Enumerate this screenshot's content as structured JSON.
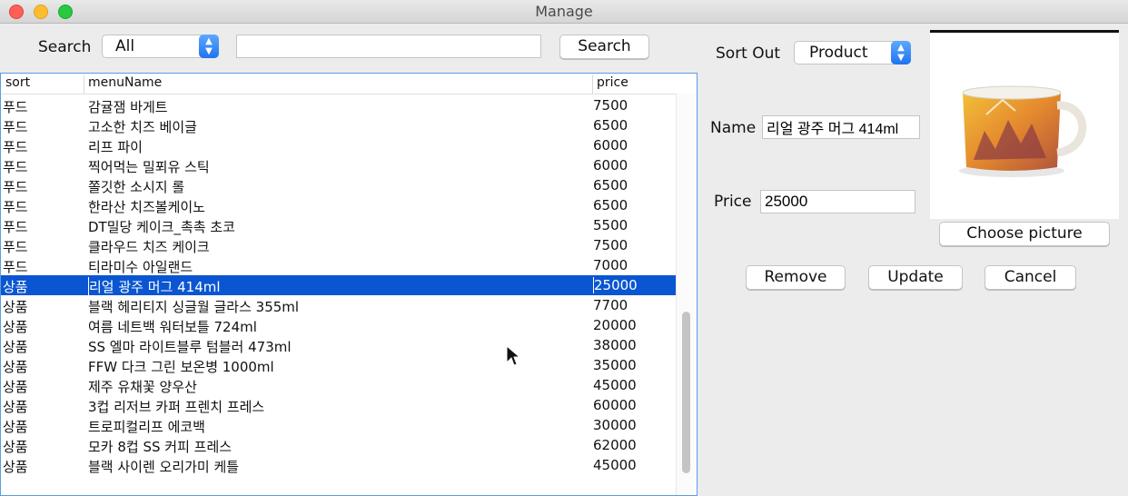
{
  "window": {
    "title": "Manage"
  },
  "search": {
    "label": "Search",
    "filter_value": "All",
    "query_value": "",
    "button_label": "Search"
  },
  "table": {
    "headers": {
      "sort": "sort",
      "menuName": "menuName",
      "price": "price"
    },
    "rows": [
      {
        "sort": "푸드",
        "menuName": "감귤잼 바게트",
        "price": "7500"
      },
      {
        "sort": "푸드",
        "menuName": "고소한 치즈 베이글",
        "price": "6500"
      },
      {
        "sort": "푸드",
        "menuName": "리프 파이",
        "price": "6000"
      },
      {
        "sort": "푸드",
        "menuName": "찍어먹는 밀푀유 스틱",
        "price": "6000"
      },
      {
        "sort": "푸드",
        "menuName": "쫄깃한 소시지 롤",
        "price": "6500"
      },
      {
        "sort": "푸드",
        "menuName": "한라산 치즈볼케이노",
        "price": "6500"
      },
      {
        "sort": "푸드",
        "menuName": "DT밀당 케이크_촉촉 초코",
        "price": "5500"
      },
      {
        "sort": "푸드",
        "menuName": "클라우드 치즈 케이크",
        "price": "7500"
      },
      {
        "sort": "푸드",
        "menuName": "티라미수 아일랜드",
        "price": "7000"
      },
      {
        "sort": "상품",
        "menuName": "리얼 광주 머그 414ml",
        "price": "25000"
      },
      {
        "sort": "상품",
        "menuName": "블랙 헤리티지 싱글월 글라스 355ml",
        "price": "7700"
      },
      {
        "sort": "상품",
        "menuName": "여름 네트백 워터보틀 724ml",
        "price": "20000"
      },
      {
        "sort": "상품",
        "menuName": "SS 엘마 라이트블루 텀블러 473ml",
        "price": "38000"
      },
      {
        "sort": "상품",
        "menuName": "FFW 다크 그린 보온병 1000ml",
        "price": "35000"
      },
      {
        "sort": "상품",
        "menuName": "제주 유채꽃 양우산",
        "price": "45000"
      },
      {
        "sort": "상품",
        "menuName": "3컵 리저브 카퍼 프렌치 프레스",
        "price": "60000"
      },
      {
        "sort": "상품",
        "menuName": "트로피컬리프 에코백",
        "price": "30000"
      },
      {
        "sort": "상품",
        "menuName": "모카 8컵 SS 커피 프레스",
        "price": "62000"
      },
      {
        "sort": "상품",
        "menuName": "블랙 사이렌 오리가미 케틀",
        "price": "45000"
      }
    ],
    "selected_index": 9
  },
  "form": {
    "sort_out_label": "Sort Out",
    "sort_out_value": "Product",
    "name_label": "Name",
    "name_value": "리얼 광주 머그 414ml",
    "price_label": "Price",
    "price_value": "25000",
    "choose_picture_label": "Choose picture",
    "remove_label": "Remove",
    "update_label": "Update",
    "cancel_label": "Cancel"
  },
  "colors": {
    "selection": "#0a56d2",
    "accent": "#1f74f0"
  },
  "icons": {
    "picture": "mug-image",
    "cursor": "arrow-cursor"
  }
}
